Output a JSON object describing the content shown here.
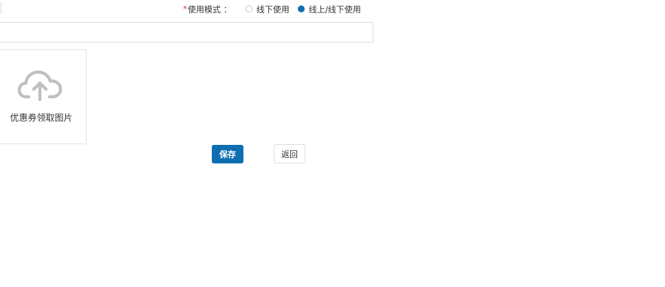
{
  "usage_mode": {
    "required_mark": "*",
    "label": "使用模式 ：",
    "options": [
      {
        "label": "线下使用",
        "checked": false
      },
      {
        "label": "线上/线下使用",
        "checked": true
      }
    ]
  },
  "upload": {
    "icon": "cloud-upload-icon",
    "label": "优惠券领取图片"
  },
  "actions": {
    "save_label": "保存",
    "back_label": "返回"
  },
  "colors": {
    "primary": "#0e6fb0",
    "required": "#e4393c",
    "border": "#dcdcdc",
    "icon_gray": "#bfbfbf"
  }
}
